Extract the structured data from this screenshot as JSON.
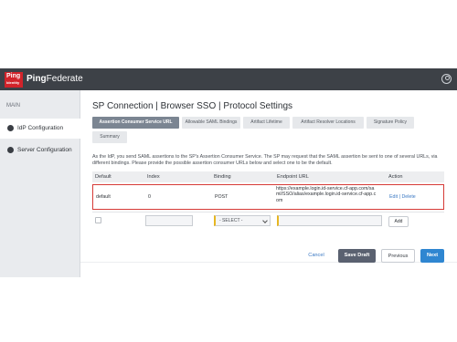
{
  "app": {
    "logo_text": "Ping",
    "logo_sub": "Identity",
    "brand_prefix": "Ping",
    "brand_suffix": "Federate"
  },
  "sidebar": {
    "section": "MAIN",
    "items": [
      {
        "label": "IdP Configuration",
        "active": true
      },
      {
        "label": "Server Configuration",
        "active": false
      }
    ]
  },
  "page": {
    "title": "SP Connection | Browser SSO | Protocol Settings",
    "tabs": [
      {
        "label": "Assertion Consumer Service URL",
        "active": true
      },
      {
        "label": "Allowable SAML Bindings"
      },
      {
        "label": "Artifact Lifetime"
      },
      {
        "label": "Artifact Resolver Locations"
      },
      {
        "label": "Signature Policy"
      },
      {
        "label": "Summary"
      }
    ],
    "description": "As the IdP, you send SAML assertions to the SP's Assertion Consumer Service. The SP may request that the SAML assertion be sent to one of several URLs, via different bindings. Please provide the possible assertion consumer URLs below and select one to be the default."
  },
  "table": {
    "headers": [
      "Default",
      "Index",
      "Binding",
      "Endpoint URL",
      "Action"
    ],
    "rows": [
      {
        "default": "default",
        "index": "0",
        "binding": "POST",
        "endpoint_url": "https://example.login.id-service.cf-app.com/saml/SSO/alias/example.login.id-service.cf-app.com",
        "action": "Edit | Delete"
      }
    ],
    "new_row": {
      "binding_select": "- SELECT -",
      "add_label": "Add"
    }
  },
  "footer": {
    "cancel": "Cancel",
    "save_draft": "Save Draft",
    "previous": "Previous",
    "next": "Next"
  },
  "colors": {
    "topbar": "#3d4147",
    "active_tab": "#7b8592",
    "highlight_border": "#d63a37",
    "link": "#3a78c3",
    "primary": "#2f86d1"
  }
}
